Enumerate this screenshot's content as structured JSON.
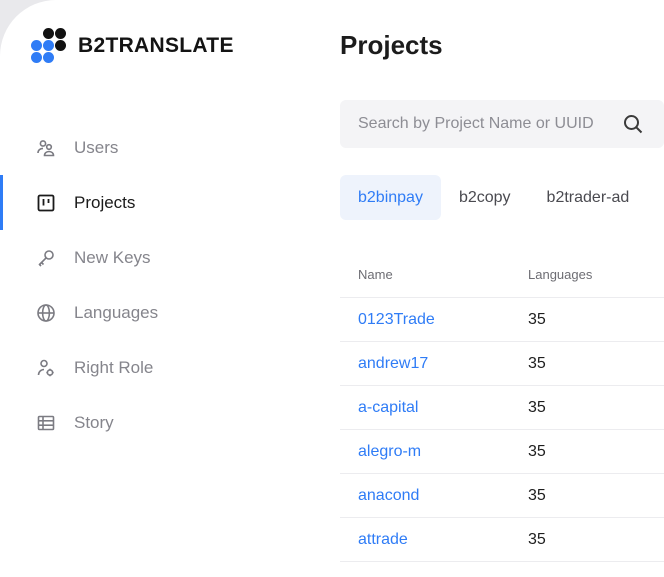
{
  "app": {
    "name": "B2TRANSLATE"
  },
  "colors": {
    "accent": "#2f7cf6",
    "active_tab_bg": "#eef3fc"
  },
  "sidebar": {
    "items": [
      {
        "label": "Users",
        "icon": "users-icon",
        "active": false
      },
      {
        "label": "Projects",
        "icon": "projects-icon",
        "active": true
      },
      {
        "label": "New Keys",
        "icon": "key-icon",
        "active": false
      },
      {
        "label": "Languages",
        "icon": "globe-icon",
        "active": false
      },
      {
        "label": "Right Role",
        "icon": "role-icon",
        "active": false
      },
      {
        "label": "Story",
        "icon": "list-icon",
        "active": false
      }
    ]
  },
  "main": {
    "title": "Projects",
    "search": {
      "placeholder": "Search by Project Name or UUID",
      "value": ""
    },
    "tabs": [
      {
        "label": "b2binpay",
        "active": true
      },
      {
        "label": "b2copy",
        "active": false
      },
      {
        "label": "b2trader-ad",
        "active": false
      }
    ],
    "table": {
      "columns": [
        "Name",
        "Languages"
      ],
      "rows": [
        {
          "name": "0123Trade",
          "languages": "35"
        },
        {
          "name": "andrew17",
          "languages": "35"
        },
        {
          "name": "a-capital",
          "languages": "35"
        },
        {
          "name": "alegro-m",
          "languages": "35"
        },
        {
          "name": "anacond",
          "languages": "35"
        },
        {
          "name": "attrade",
          "languages": "35"
        }
      ]
    }
  }
}
